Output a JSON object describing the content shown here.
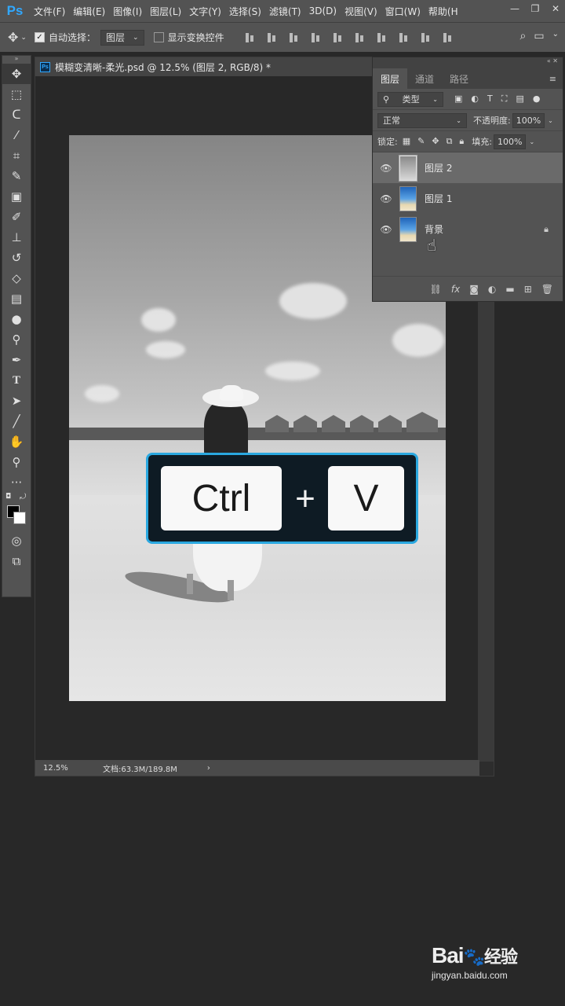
{
  "app": {
    "logo": "Ps",
    "menu": [
      "文件(F)",
      "编辑(E)",
      "图像(I)",
      "图层(L)",
      "文字(Y)",
      "选择(S)",
      "滤镜(T)",
      "3D(D)",
      "视图(V)",
      "窗口(W)",
      "帮助(H"
    ]
  },
  "options": {
    "auto_select_label": "自动选择：",
    "auto_select_value": "图层",
    "show_transform_label": "显示变换控件"
  },
  "document": {
    "title": "模糊变清晰-柔光.psd @ 12.5% (图层 2, RGB/8) *",
    "zoom": "12.5%",
    "doc_size": "文档:63.3M/189.8M",
    "status_arrow": "›"
  },
  "shortcut": {
    "key1": "Ctrl",
    "plus": "+",
    "key2": "V",
    "border_color": "#2aa8e0"
  },
  "layers_panel": {
    "tabs": [
      "图层",
      "通道",
      "路径"
    ],
    "filter_label": "类型",
    "blend_mode": "正常",
    "opacity_label": "不透明度:",
    "opacity_value": "100%",
    "lock_label": "锁定:",
    "fill_label": "填充:",
    "fill_value": "100%",
    "layers": [
      {
        "name": "图层 2",
        "selected": true
      },
      {
        "name": "图层 1",
        "selected": false
      },
      {
        "name": "背景",
        "selected": false,
        "locked": true
      }
    ]
  },
  "watermark": {
    "logo_text": "Bai",
    "logo_paw": "🐾",
    "logo_suffix": "经验",
    "url": "jingyan.baidu.com"
  }
}
